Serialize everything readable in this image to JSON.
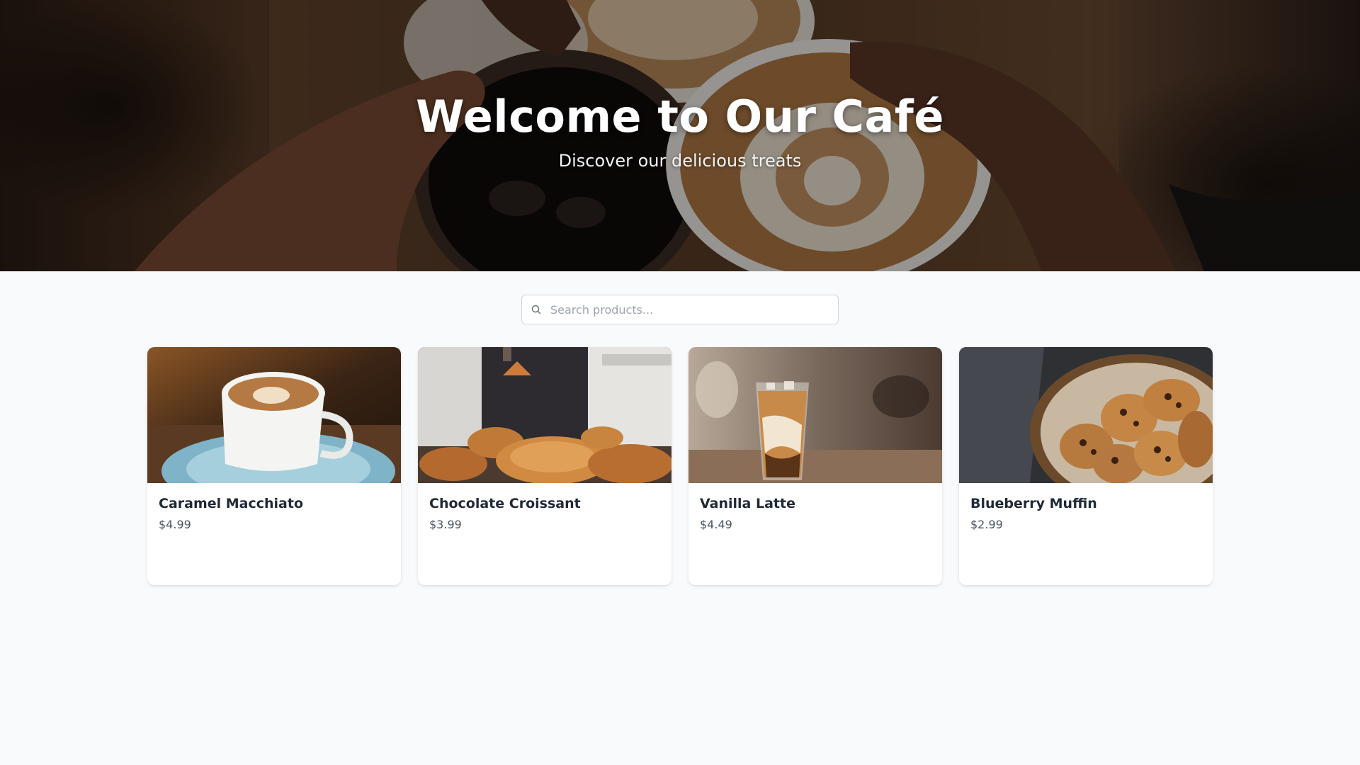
{
  "hero": {
    "title": "Welcome to Our Café",
    "subtitle": "Discover our delicious treats"
  },
  "search": {
    "placeholder": "Search products...",
    "icon": "search-icon"
  },
  "products": [
    {
      "name": "Caramel Macchiato",
      "price": "$4.99",
      "image": "coffee-cup-image"
    },
    {
      "name": "Chocolate Croissant",
      "price": "$3.99",
      "image": "croissant-image"
    },
    {
      "name": "Vanilla Latte",
      "price": "$4.49",
      "image": "iced-latte-image"
    },
    {
      "name": "Blueberry Muffin",
      "price": "$2.99",
      "image": "cookies-basket-image"
    }
  ],
  "colors": {
    "page_background": "#f8fafc",
    "card_background": "#ffffff",
    "title_text": "#1f2937",
    "price_text": "#4b5563"
  }
}
